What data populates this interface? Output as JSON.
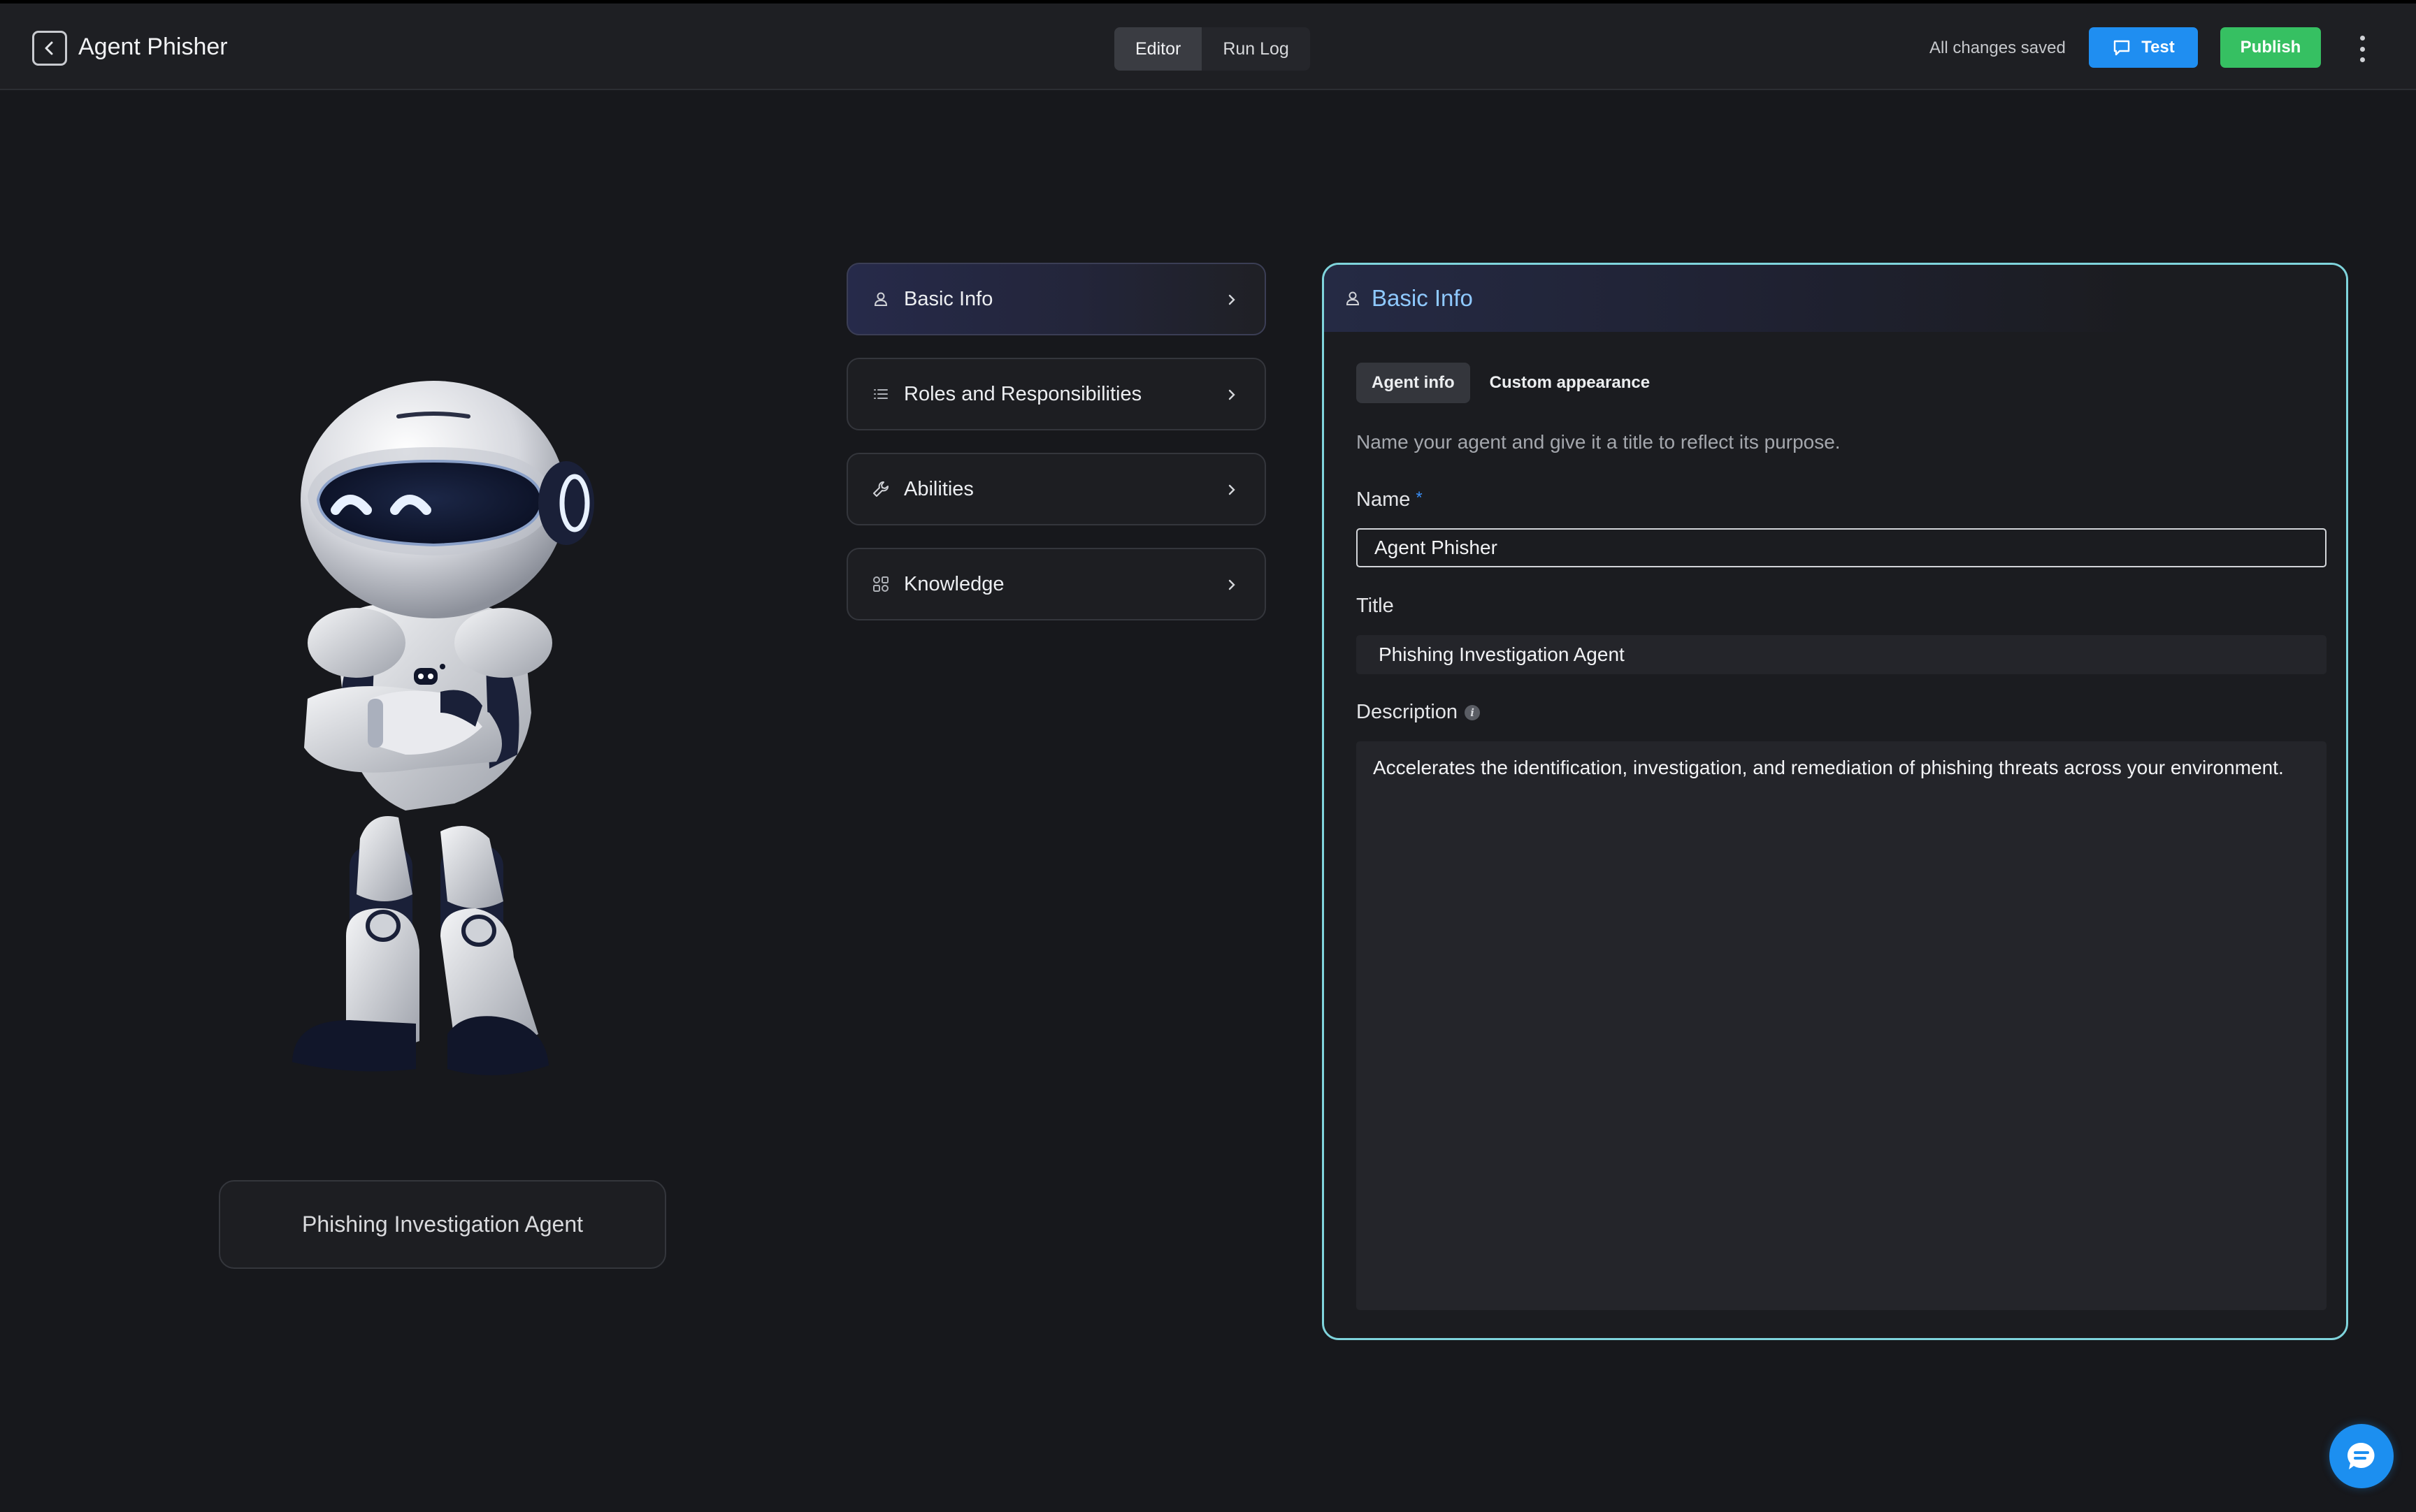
{
  "header": {
    "title": "Agent Phisher",
    "tabs": [
      {
        "label": "Editor",
        "active": true
      },
      {
        "label": "Run Log",
        "active": false
      }
    ],
    "status_text": "All changes saved",
    "test_label": "Test",
    "publish_label": "Publish"
  },
  "agent_card": {
    "label": "Phishing Investigation Agent"
  },
  "nav": {
    "items": [
      {
        "label": "Basic Info",
        "icon": "user-icon",
        "active": true
      },
      {
        "label": "Roles and Responsibilities",
        "icon": "list-icon",
        "active": false
      },
      {
        "label": "Abilities",
        "icon": "wrench-icon",
        "active": false
      },
      {
        "label": "Knowledge",
        "icon": "knowledge-icon",
        "active": false
      }
    ]
  },
  "panel": {
    "title": "Basic Info",
    "subtabs": [
      {
        "label": "Agent info",
        "active": true
      },
      {
        "label": "Custom appearance",
        "active": false
      }
    ],
    "helper_text": "Name your agent and give it a title to reflect its purpose.",
    "name_label": "Name",
    "name_required_mark": "*",
    "name_value": "Agent Phisher",
    "title_label": "Title",
    "title_value": "Phishing Investigation Agent",
    "description_label": "Description",
    "description_value": "Accelerates the identification, investigation, and remediation of phishing threats across your environment."
  },
  "colors": {
    "accent_blue": "#1f8ef1",
    "publish_green": "#36c062",
    "panel_border": "#7fd4dc",
    "panel_title": "#8fc9ff"
  }
}
